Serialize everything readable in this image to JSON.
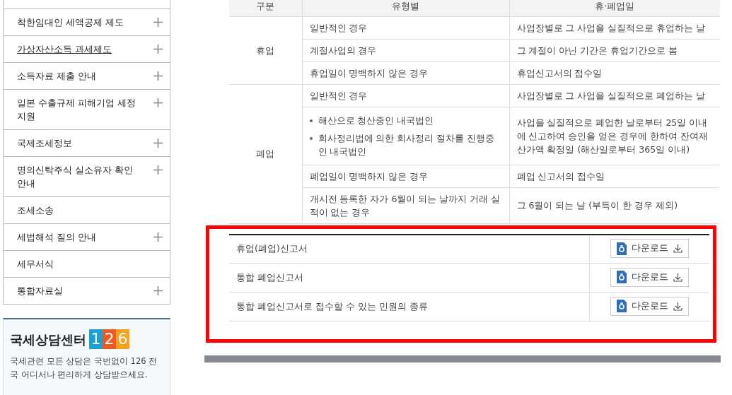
{
  "sidebar": {
    "items": [
      {
        "label": "착한임대인 세액공제 제도",
        "expandable": true,
        "hovered": false
      },
      {
        "label": "가상자산소득 과세제도",
        "expandable": true,
        "hovered": true
      },
      {
        "label": "소득자료 제출 안내",
        "expandable": true,
        "hovered": false
      },
      {
        "label": "일본 수출규제 피해기업 세정지원",
        "expandable": true,
        "hovered": false
      },
      {
        "label": "국제조세정보",
        "expandable": true,
        "hovered": false
      },
      {
        "label": "명의신탁주식 실소유자 확인안내",
        "expandable": true,
        "hovered": false
      },
      {
        "label": "조세소송",
        "expandable": false,
        "hovered": false
      },
      {
        "label": "세법해석 질의 안내",
        "expandable": true,
        "hovered": false
      },
      {
        "label": "세무서식",
        "expandable": false,
        "hovered": false
      },
      {
        "label": "통합자료실",
        "expandable": true,
        "hovered": false
      }
    ]
  },
  "counsel_center": {
    "title": "국세상담센터",
    "number": "126",
    "text": "국세관련 모든 상담은 국번없이 126 전국 어디서나 편리하게 상담받으세요."
  },
  "table": {
    "columns": [
      "구분",
      "유형별",
      "휴·폐업일"
    ],
    "groups": [
      {
        "label": "휴업",
        "rows": [
          {
            "case": [
              "일반적인 경우"
            ],
            "date": "사업장별로 그 사업을 실질적으로 휴업하는 날"
          },
          {
            "case": [
              "계절사업의 경우"
            ],
            "date": "그 계절이 아닌 기간은 휴업기간으로 봄"
          },
          {
            "case": [
              "휴업일이 명백하지 않은 경우"
            ],
            "date": "휴업신고서의 접수일"
          }
        ]
      },
      {
        "label": "폐업",
        "rows": [
          {
            "case": [
              "일반적인 경우"
            ],
            "date": "사업장별로 그 사업을 실질적으로 폐업하는 날"
          },
          {
            "case": [
              "해산으로 청산중인 내국법인",
              "회사정리법에 의한 회사정리 절차를 진행중인 내국법인"
            ],
            "date": "사업을 실질적으로 폐업한 날로부터 25일 이내에 신고하여 승인을 얻은 경우에 한하여 잔여재산가액 확정일 (해산일로부터 365일 이내)"
          },
          {
            "case": [
              "폐업일이 명백하지 않은 경우"
            ],
            "date": "폐업 신고서의 접수일"
          },
          {
            "case": [
              "개시전 등록한 자가 6월이 되는 날까지 거래 실적이 없는 경우"
            ],
            "date": "그 6월이 되는 날 (부득이 한 경우 제외)"
          }
        ]
      }
    ]
  },
  "downloads": [
    {
      "name": "휴업(폐업)신고서",
      "button": "다운로드"
    },
    {
      "name": "통합 폐업신고서",
      "button": "다운로드"
    },
    {
      "name": "통합 폐업신고서로 접수할 수 있는 민원의 종류",
      "button": "다운로드"
    }
  ]
}
